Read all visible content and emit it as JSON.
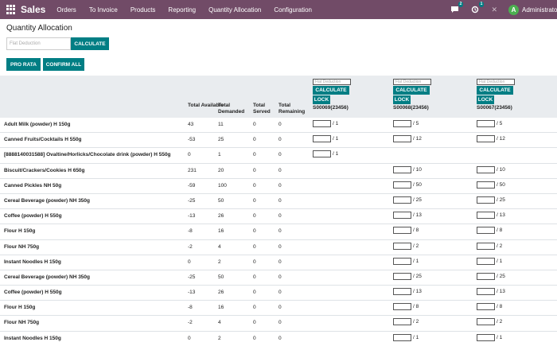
{
  "navbar": {
    "brand": "Sales",
    "menu": [
      "Orders",
      "To Invoice",
      "Products",
      "Reporting",
      "Quantity Allocation",
      "Configuration"
    ],
    "messages_count": "2",
    "activities_count": "1",
    "avatar_letter": "A",
    "user_name": "Administrator"
  },
  "page": {
    "title": "Quantity Allocation",
    "flat_deduction_placeholder": "Flat Deduction",
    "calculate_label": "CALCULATE",
    "pro_rata_label": "PRO RATA",
    "confirm_all_label": "CONFIRM ALL"
  },
  "table": {
    "headers": {
      "total_available": "Total Available",
      "total_demanded": "Total Demanded",
      "total_served": "Total Served",
      "total_remaining": "Total Remaining"
    },
    "columns": [
      {
        "code": "S00069(23456)",
        "placeholder": "Flat Deduction",
        "calculate": "CALCULATE",
        "lock": "LOCK"
      },
      {
        "code": "S00068(23456)",
        "placeholder": "Flat Deduction",
        "calculate": "CALCULATE",
        "lock": "LOCK"
      },
      {
        "code": "S00067(23456)",
        "placeholder": "Flat Deduction",
        "calculate": "CALCULATE",
        "lock": "LOCK"
      }
    ],
    "rows": [
      {
        "name": "Adult Milk (powder) H 150g",
        "available": "43",
        "demanded": "11",
        "served": "0",
        "remaining": "0",
        "q": [
          "/ 1",
          "/ 5",
          "/ 5"
        ]
      },
      {
        "name": "Canned Fruits/Cocktails H 550g",
        "available": "-53",
        "demanded": "25",
        "served": "0",
        "remaining": "0",
        "q": [
          "/ 1",
          "/ 12",
          "/ 12"
        ]
      },
      {
        "name": "[8888140031588] Ovaltine/Horlicks/Chocolate drink (powder) H 550g",
        "available": "0",
        "demanded": "1",
        "served": "0",
        "remaining": "0",
        "q": [
          "/ 1",
          "",
          ""
        ]
      },
      {
        "name": "Biscuit/Crackers/Cookies H 650g",
        "available": "231",
        "demanded": "20",
        "served": "0",
        "remaining": "0",
        "q": [
          "",
          "/ 10",
          "/ 10"
        ]
      },
      {
        "name": "Canned Pickles NH 50g",
        "available": "-59",
        "demanded": "100",
        "served": "0",
        "remaining": "0",
        "q": [
          "",
          "/ 50",
          "/ 50"
        ]
      },
      {
        "name": "Cereal Beverage (powder) NH 350g",
        "available": "-25",
        "demanded": "50",
        "served": "0",
        "remaining": "0",
        "q": [
          "",
          "/ 25",
          "/ 25"
        ]
      },
      {
        "name": "Coffee (powder) H 550g",
        "available": "-13",
        "demanded": "26",
        "served": "0",
        "remaining": "0",
        "q": [
          "",
          "/ 13",
          "/ 13"
        ]
      },
      {
        "name": "Flour H 150g",
        "available": "-8",
        "demanded": "16",
        "served": "0",
        "remaining": "0",
        "q": [
          "",
          "/ 8",
          "/ 8"
        ]
      },
      {
        "name": "Flour NH 750g",
        "available": "-2",
        "demanded": "4",
        "served": "0",
        "remaining": "0",
        "q": [
          "",
          "/ 2",
          "/ 2"
        ]
      },
      {
        "name": "Instant Noodles H 150g",
        "available": "0",
        "demanded": "2",
        "served": "0",
        "remaining": "0",
        "q": [
          "",
          "/ 1",
          "/ 1"
        ]
      },
      {
        "name": "Cereal Beverage (powder) NH 350g",
        "available": "-25",
        "demanded": "50",
        "served": "0",
        "remaining": "0",
        "q": [
          "",
          "/ 25",
          "/ 25"
        ]
      },
      {
        "name": "Coffee (powder) H 550g",
        "available": "-13",
        "demanded": "26",
        "served": "0",
        "remaining": "0",
        "q": [
          "",
          "/ 13",
          "/ 13"
        ]
      },
      {
        "name": "Flour H 150g",
        "available": "-8",
        "demanded": "16",
        "served": "0",
        "remaining": "0",
        "q": [
          "",
          "/ 8",
          "/ 8"
        ]
      },
      {
        "name": "Flour NH 750g",
        "available": "-2",
        "demanded": "4",
        "served": "0",
        "remaining": "0",
        "q": [
          "",
          "/ 2",
          "/ 2"
        ]
      },
      {
        "name": "Instant Noodles H 150g",
        "available": "0",
        "demanded": "2",
        "served": "0",
        "remaining": "0",
        "q": [
          "",
          "/ 1",
          "/ 1"
        ]
      }
    ]
  }
}
